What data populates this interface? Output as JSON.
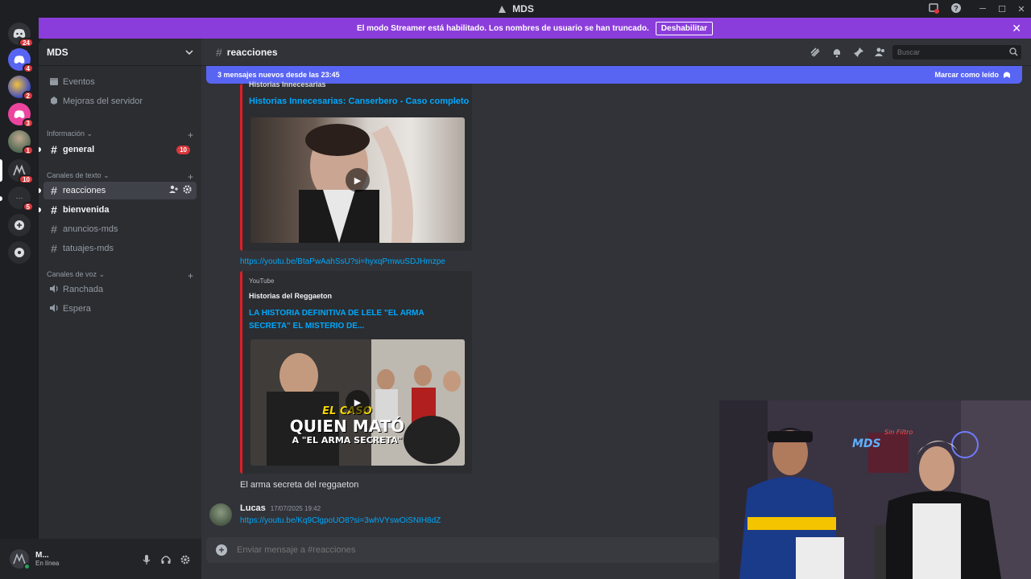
{
  "window": {
    "title": "MDS"
  },
  "guilds": [
    {
      "name": "discord-home",
      "badge": "24",
      "color": "#313338"
    },
    {
      "name": "server-2",
      "badge": "4",
      "color": "#5865f2"
    },
    {
      "name": "server-3",
      "badge": "2",
      "color": "#3d4bc4"
    },
    {
      "name": "server-4",
      "badge": "3",
      "color": "#eb459e"
    },
    {
      "name": "server-5",
      "badge": "1",
      "color": "#6d6f78"
    },
    {
      "name": "server-6",
      "badge": "10",
      "color": "#2b2d31"
    },
    {
      "name": "server-7",
      "badge": "5",
      "color": "#2b2d31"
    }
  ],
  "banner": {
    "text": "El modo Streamer está habilitado. Los nombres de usuario se han truncado.",
    "button": "Deshabilitar"
  },
  "server": {
    "name": "MDS"
  },
  "sidebar": {
    "events": "Eventos",
    "boosts": "Mejoras del servidor",
    "categories": [
      {
        "label": "Información"
      },
      {
        "label": "Canales de texto"
      },
      {
        "label": "Canales de voz"
      }
    ],
    "channels": [
      {
        "name": "general",
        "badge": "10"
      },
      {
        "name": "reacciones"
      },
      {
        "name": "bienvenida"
      },
      {
        "name": "anuncios-mds"
      },
      {
        "name": "tatuajes-mds"
      },
      {
        "name": "Ranchada"
      },
      {
        "name": "Espera"
      }
    ]
  },
  "user": {
    "name": "M...",
    "status": "En línea"
  },
  "channel": {
    "name": "reacciones",
    "search_placeholder": "Buscar"
  },
  "newbar": {
    "text": "3 mensajes nuevos desde las 23:45",
    "action": "Marcar como leído"
  },
  "messages": {
    "embed1": {
      "provider": "Historias Innecesarias",
      "title": "Historias Innecesarias: Canserbero - Caso completo"
    },
    "link2": "https://youtu.be/BtaPwAahSsU?si=hyxqPmwuSDJHmzpe",
    "embed2": {
      "provider": "YouTube",
      "author": "Historias del Reggaeton",
      "title_line1": "LA HISTORIA DEFINITIVA DE LELE \"EL ARMA",
      "title_line2": "SECRETA\" EL MISTERIO DE...",
      "thumb_text1": "EL CASO",
      "thumb_text2": "QUIEN MATÓ",
      "thumb_text3": "A \"EL ARMA SECRETA\""
    },
    "text3": "El arma secreta del reggaeton",
    "msg4": {
      "author": "Lucas",
      "time": "17/07/2025 19:42",
      "link": "https://youtu.be/Kq9ClgpoUO8?si=3whVYswOiSNIH8dZ"
    }
  },
  "composer": {
    "placeholder": "Enviar mensaje a #reacciones"
  }
}
